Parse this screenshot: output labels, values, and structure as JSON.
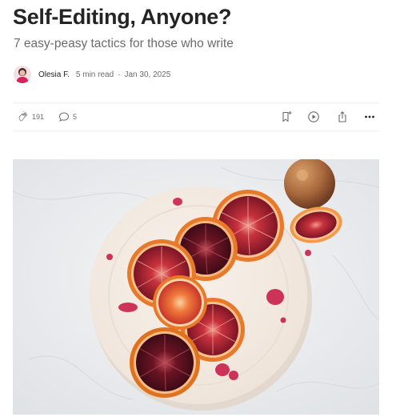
{
  "article": {
    "title": "Self-Editing, Anyone?",
    "subtitle": "7 easy-peasy tactics for those who write"
  },
  "byline": {
    "author": "Olesia F.",
    "read_time": "5 min read",
    "separator": "·",
    "date": "Jan 30, 2025"
  },
  "actions": {
    "claps": "191",
    "responses": "5",
    "icons": [
      "clap-icon",
      "comment-icon",
      "bookmark-icon",
      "play-icon",
      "share-icon",
      "more-icon"
    ]
  },
  "hero_image": {
    "description_icon": "blood-orange-plate-photo"
  },
  "colors": {
    "text": "#242424",
    "muted": "#6b6b6b",
    "divider": "#f0f0f0",
    "fruit_red": "#8e1b2b",
    "fruit_rind": "#e8782a"
  }
}
